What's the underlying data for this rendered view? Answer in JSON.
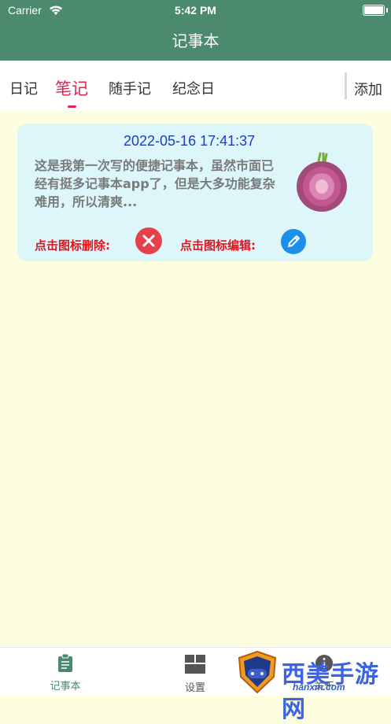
{
  "status": {
    "carrier": "Carrier",
    "time": "5:42 PM"
  },
  "header": {
    "title": "记事本"
  },
  "tabs": [
    {
      "label": "日记"
    },
    {
      "label": "笔记"
    },
    {
      "label": "随手记"
    },
    {
      "label": "纪念日"
    }
  ],
  "add_label": "添加",
  "note": {
    "date": "2022-05-16 17:41:37",
    "text": "这是我第一次写的便捷记事本，虽然市面已经有挺多记事本app了，但是大多功能复杂难用，所以清爽...",
    "delete_label": "点击图标删除:",
    "edit_label": "点击图标编辑:"
  },
  "bottom": [
    {
      "label": "记事本"
    },
    {
      "label": "设置"
    },
    {
      "label": "关于"
    }
  ],
  "watermark": {
    "text": "西美手游网",
    "url": "hanxm.com"
  },
  "colors": {
    "header": "#4b8a6c",
    "accent": "#d9264f",
    "card": "#dcf6fa",
    "background": "#fdfde0"
  }
}
